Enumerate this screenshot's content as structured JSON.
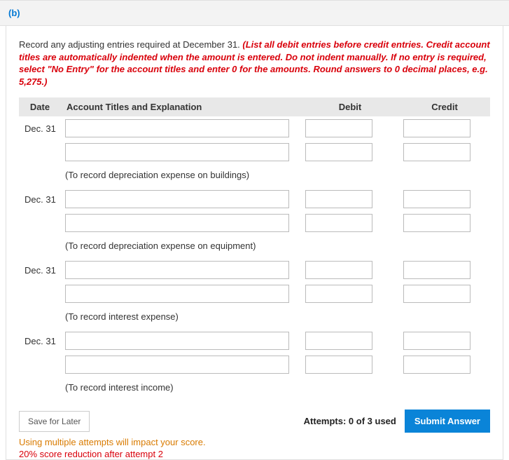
{
  "tab": {
    "label": "(b)"
  },
  "instructions": {
    "plain": "Record any adjusting entries required at December 31. ",
    "italic": "(List all debit entries before credit entries. Credit account titles are automatically indented when the amount is entered. Do not indent manually. If no entry is required, select \"No Entry\" for the account titles and enter 0 for the amounts. Round answers to 0 decimal places, e.g. 5,275.)"
  },
  "table": {
    "headers": {
      "date": "Date",
      "account": "Account Titles and Explanation",
      "debit": "Debit",
      "credit": "Credit"
    },
    "entries": [
      {
        "date": "Dec. 31",
        "explanation": "(To record depreciation expense on buildings)"
      },
      {
        "date": "Dec. 31",
        "explanation": "(To record depreciation expense on equipment)"
      },
      {
        "date": "Dec. 31",
        "explanation": "(To record interest expense)"
      },
      {
        "date": "Dec. 31",
        "explanation": "(To record interest income)"
      }
    ]
  },
  "footer": {
    "save": "Save for Later",
    "attempts": "Attempts: 0 of 3 used",
    "submit": "Submit Answer",
    "warn1": "Using multiple attempts will impact your score.",
    "warn2": "20% score reduction after attempt 2"
  }
}
